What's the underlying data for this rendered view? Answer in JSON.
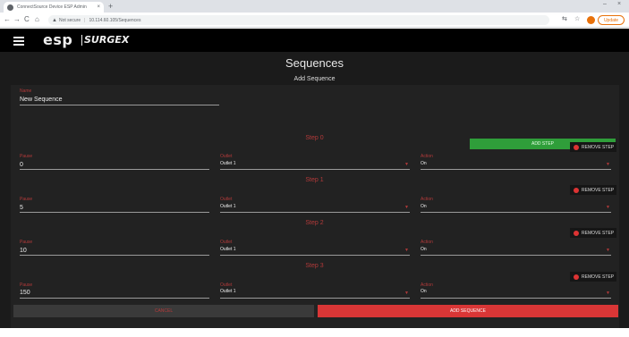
{
  "browser": {
    "tab_title": "ConnectSource Device ESP Admin",
    "tab_close": "×",
    "new_tab": "+",
    "minimize": "–",
    "close": "×",
    "back": "←",
    "forward": "→",
    "reload": "C",
    "home": "⌂",
    "warning": "▲",
    "not_secure": "Not secure",
    "url_sep": "|",
    "url": "10.114.60.105/Sequences",
    "share_icon": "⇆",
    "star_icon": "☆",
    "update_label": "Update"
  },
  "appbar": {
    "logo_left": "esp",
    "logo_right": "SURGEX"
  },
  "page": {
    "title": "Sequences",
    "subtitle": "Add Sequence"
  },
  "form": {
    "name_label": "Name",
    "name_value": "New Sequence",
    "add_step_label": "ADD STEP",
    "remove_step_label": "REMOVE STEP",
    "pause_label": "Pause",
    "outlet_label": "Outlet",
    "action_label": "Action",
    "arrow": "▼",
    "steps": [
      {
        "title": "Step 0",
        "pause": "0",
        "outlet": "Outlet 1",
        "action": "On"
      },
      {
        "title": "Step 1",
        "pause": "5",
        "outlet": "Outlet 1",
        "action": "On"
      },
      {
        "title": "Step 2",
        "pause": "10",
        "outlet": "Outlet 1",
        "action": "On"
      },
      {
        "title": "Step 3",
        "pause": "150",
        "outlet": "Outlet 1",
        "action": "On"
      }
    ]
  },
  "footer": {
    "cancel_label": "CANCEL",
    "add_sequence_label": "ADD SEQUENCE"
  },
  "colors": {
    "accent_red": "#d93636",
    "add_step_green": "#2f9e3a",
    "label_red": "#b33a3a"
  }
}
